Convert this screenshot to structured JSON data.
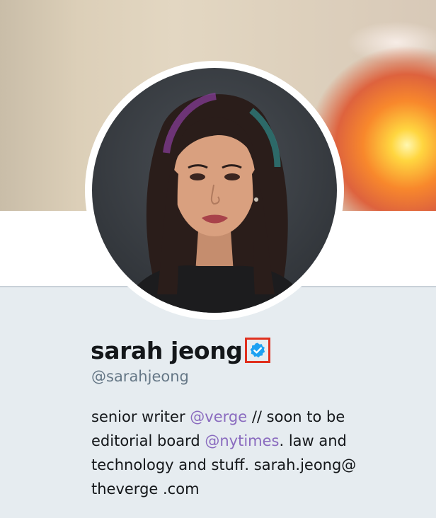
{
  "profile": {
    "name": "sarah jeong",
    "handle": "@sarahjeong",
    "verified_icon": "verified-badge-icon",
    "avatar": "profile-photo",
    "banner": "header-photo"
  },
  "bio": {
    "line1_pre": "senior writer ",
    "line1_mention": "@verge",
    "line1_post": " // soon to be",
    "line2_pre": "editorial board ",
    "line2_mention": "@nytimes",
    "line2_post": ". law and",
    "line3": "technology and stuff. sarah.jeong@",
    "line4": "theverge .com"
  },
  "colors": {
    "background": "#e6ecf0",
    "link": "#8a6bbf",
    "verified": "#1da1f2",
    "highlight": "#e0301e",
    "handle": "#657786"
  }
}
